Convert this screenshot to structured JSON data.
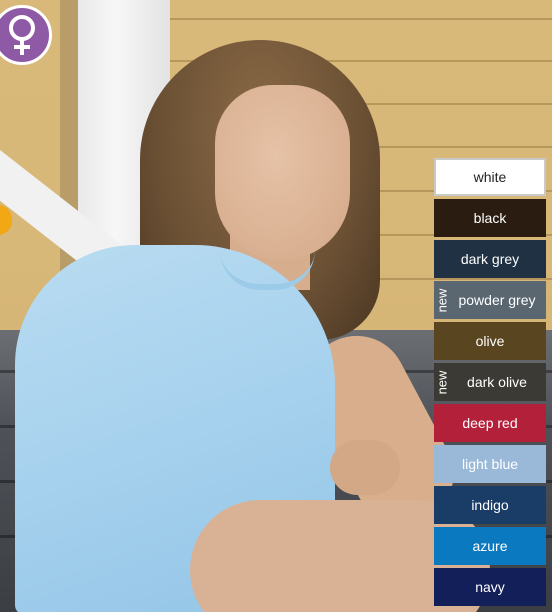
{
  "badge": {
    "icon": "female-symbol-icon",
    "color": "#8f5aa5"
  },
  "swatches": [
    {
      "label": "white",
      "color": "#ffffff",
      "text_color": "#222222",
      "new": false
    },
    {
      "label": "black",
      "color": "#2a1c10",
      "text_color": "#ffffff",
      "new": false
    },
    {
      "label": "dark grey",
      "color": "#1f3143",
      "text_color": "#ffffff",
      "new": false
    },
    {
      "label": "powder grey",
      "color": "#5a6670",
      "text_color": "#ffffff",
      "new": true,
      "new_label": "new"
    },
    {
      "label": "olive",
      "color": "#594520",
      "text_color": "#ffffff",
      "new": false
    },
    {
      "label": "dark olive",
      "color": "#3b3a35",
      "text_color": "#ffffff",
      "new": true,
      "new_label": "new"
    },
    {
      "label": "deep red",
      "color": "#b3203a",
      "text_color": "#ffffff",
      "new": false
    },
    {
      "label": "light blue",
      "color": "#9ab9d8",
      "text_color": "#ffffff",
      "new": false
    },
    {
      "label": "indigo",
      "color": "#1a3d68",
      "text_color": "#ffffff",
      "new": false
    },
    {
      "label": "azure",
      "color": "#0a79bf",
      "text_color": "#ffffff",
      "new": false
    },
    {
      "label": "navy",
      "color": "#131f58",
      "text_color": "#ffffff",
      "new": false
    }
  ]
}
